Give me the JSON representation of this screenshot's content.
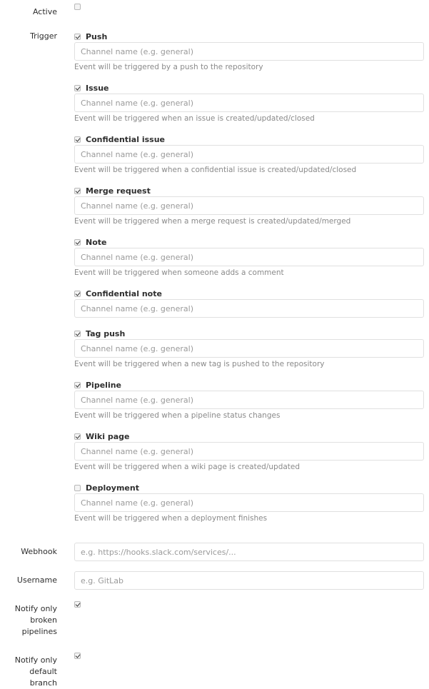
{
  "active": {
    "label": "Active",
    "checked": false
  },
  "trigger": {
    "label": "Trigger",
    "events": [
      {
        "title": "Push",
        "checked": true,
        "placeholder": "Channel name (e.g. general)",
        "help": "Event will be triggered by a push to the repository"
      },
      {
        "title": "Issue",
        "checked": true,
        "placeholder": "Channel name (e.g. general)",
        "help": "Event will be triggered when an issue is created/updated/closed"
      },
      {
        "title": "Confidential issue",
        "checked": true,
        "placeholder": "Channel name (e.g. general)",
        "help": "Event will be triggered when a confidential issue is created/updated/closed"
      },
      {
        "title": "Merge request",
        "checked": true,
        "placeholder": "Channel name (e.g. general)",
        "help": "Event will be triggered when a merge request is created/updated/merged"
      },
      {
        "title": "Note",
        "checked": true,
        "placeholder": "Channel name (e.g. general)",
        "help": "Event will be triggered when someone adds a comment"
      },
      {
        "title": "Confidential note",
        "checked": true,
        "placeholder": "Channel name (e.g. general)",
        "help": ""
      },
      {
        "title": "Tag push",
        "checked": true,
        "placeholder": "Channel name (e.g. general)",
        "help": "Event will be triggered when a new tag is pushed to the repository"
      },
      {
        "title": "Pipeline",
        "checked": true,
        "placeholder": "Channel name (e.g. general)",
        "help": "Event will be triggered when a pipeline status changes"
      },
      {
        "title": "Wiki page",
        "checked": true,
        "placeholder": "Channel name (e.g. general)",
        "help": "Event will be triggered when a wiki page is created/updated"
      },
      {
        "title": "Deployment",
        "checked": false,
        "placeholder": "Channel name (e.g. general)",
        "help": "Event will be triggered when a deployment finishes"
      }
    ]
  },
  "webhook": {
    "label": "Webhook",
    "placeholder": "e.g. https://hooks.slack.com/services/...",
    "value": ""
  },
  "username": {
    "label": "Username",
    "placeholder": "e.g. GitLab",
    "value": ""
  },
  "notify_broken": {
    "label_lines": [
      "Notify only",
      "broken",
      "pipelines"
    ],
    "checked": true
  },
  "notify_default": {
    "label_lines": [
      "Notify only",
      "default branch"
    ],
    "checked": true
  }
}
